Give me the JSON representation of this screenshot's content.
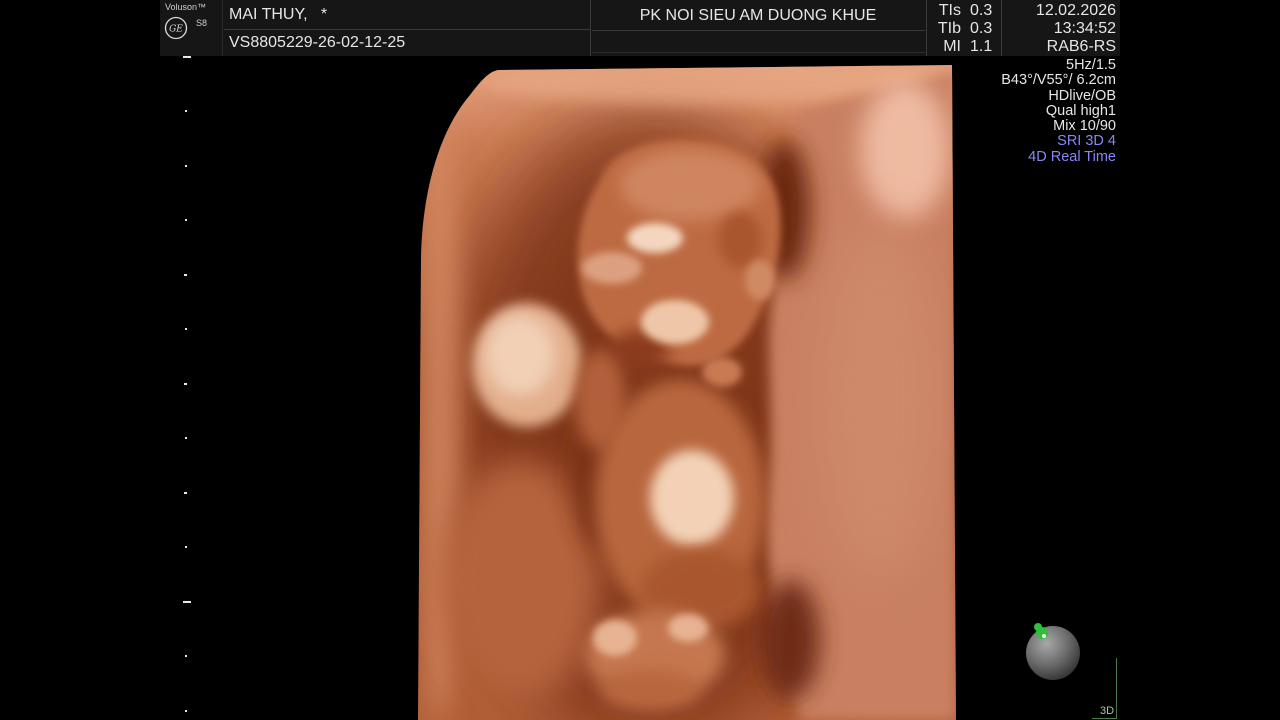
{
  "header": {
    "brand": "Voluson™",
    "model": "S8",
    "logo_text": "GE",
    "patient_name": "MAI THUY,   *",
    "exam_id": "VS8805229-26-02-12-25",
    "institution": "PK NOI SIEU AM DUONG KHUE",
    "indices": [
      {
        "label": "TIs",
        "value": "0.3"
      },
      {
        "label": "TIb",
        "value": "0.3"
      },
      {
        "label": "MI",
        "value": "1.1"
      }
    ],
    "date": "12.02.2026",
    "time": "13:34:52",
    "probe": "RAB6-RS"
  },
  "parameters": [
    "5Hz/1.5",
    "B43°/V55°/ 6.2cm",
    "HDlive/OB",
    "Qual high1",
    "Mix 10/90",
    "SRI 3D 4",
    "4D Real Time"
  ],
  "orientation": {
    "label": "3D"
  },
  "colors": {
    "background": "#000000",
    "header_background": "#161616",
    "text": "#e6e6e6",
    "mode_accent": "#8787f7",
    "orientation_marker": "#2fbf3a"
  }
}
